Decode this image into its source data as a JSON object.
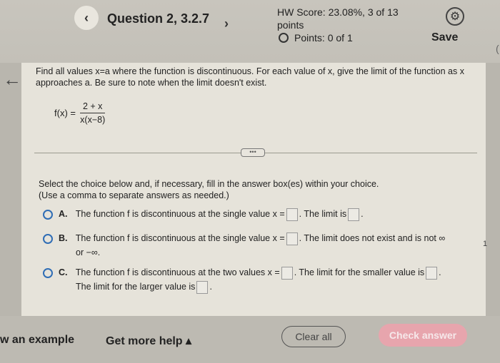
{
  "header": {
    "question_title": "Question 2, 3.2.7",
    "hw_score_label": "HW Score:",
    "hw_score_value": "23.08%, 3 of 13",
    "hw_score_line2": "points",
    "points_label": "Points:",
    "points_value": "0 of 1",
    "save_label": "Save"
  },
  "problem": {
    "prompt": "Find all values x=a where the function is discontinuous. For each value of x, give the limit of the function as x approaches a. Be sure to note when the limit doesn't exist.",
    "fx_label": "f(x) =",
    "numerator": "2 + x",
    "denominator": "x(x−8)",
    "dots": "•••"
  },
  "instructions": {
    "line1": "Select the choice below and, if necessary, fill in the answer box(es) within your choice.",
    "line2": "(Use a comma to separate answers as needed.)"
  },
  "choices": [
    {
      "letter": "A.",
      "text1": "The function f is discontinuous at the single value x =",
      "text2": ". The limit is",
      "text3": "."
    },
    {
      "letter": "B.",
      "text1": "The function f is discontinuous at the single value x =",
      "text2": ". The limit does not exist and is not ∞",
      "text3": "or −∞."
    },
    {
      "letter": "C.",
      "text1": "The function f is discontinuous at the two values x =",
      "text2": ". The limit for the smaller value is",
      "text3": ".",
      "text4": "The limit for the larger value is",
      "text5": "."
    }
  ],
  "footer": {
    "example": "w an example",
    "get_help": "Get more help ▴",
    "clear_all": "Clear all",
    "check_answer": "Check answer"
  },
  "edge": {
    "right_char": "(",
    "right_num": "1"
  }
}
